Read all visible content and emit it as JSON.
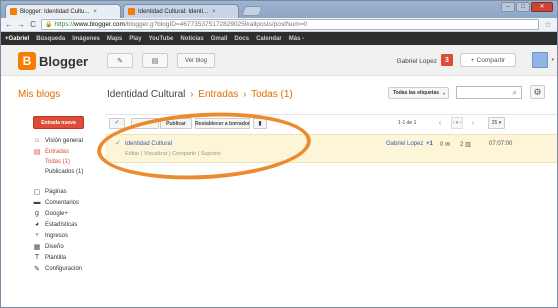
{
  "browser": {
    "tabs": [
      {
        "label": "Blogger: Identidad Cultu..."
      },
      {
        "label": "Identidad Cultural: Identi..."
      }
    ],
    "tab_close": "×",
    "address": {
      "lock": "🔒",
      "scheme": "https://",
      "host": "www.blogger.com",
      "path": "/blogger.g?blogID=467735375172829025l#allposts/postNum=0"
    },
    "back": "←",
    "forward": "→",
    "reload": "C",
    "star": "☆",
    "window_controls": {
      "minimize": "–",
      "maximize": "□",
      "close": "✕"
    }
  },
  "google_bar": {
    "items": [
      "+Gabriel",
      "Búsqueda",
      "Imágenes",
      "Maps",
      "Play",
      "YouTube",
      "Noticias",
      "Gmail",
      "Docs",
      "Calendar",
      "Más -"
    ]
  },
  "header": {
    "logo_mark": "B",
    "logo_text": "Blogger",
    "pencil": "✎",
    "pages": "▤",
    "view_blog": "Ver blog",
    "user_name": "Gabriel Lopez",
    "notifications": "3",
    "share": "+ Compartir",
    "avatar_caret": "▾"
  },
  "sidebar": {
    "title": "Mis blogs",
    "new_entry": "Entrada nueva",
    "items": [
      {
        "icon": "⌂",
        "label": "Visión general"
      },
      {
        "icon": "▤",
        "label": "Entradas"
      },
      {
        "label": "Todas (1)"
      },
      {
        "label": "Publicados (1)"
      },
      {
        "icon": "▢",
        "label": "Páginas"
      },
      {
        "icon": "▬",
        "label": "Comentarios"
      },
      {
        "icon": "g",
        "label": "Google+"
      },
      {
        "icon": "◕",
        "label": "Estadísticas"
      },
      {
        "icon": "♆",
        "label": "Ingresos"
      },
      {
        "icon": "▦",
        "label": "Diseño"
      },
      {
        "icon": "T",
        "label": "Plantilla"
      },
      {
        "icon": "✎",
        "label": "Configuración"
      }
    ]
  },
  "main": {
    "crumb_blog": "Identidad Cultural",
    "crumb_sep": "›",
    "crumb_section": "Entradas",
    "crumb_filter": "Todas (1)",
    "labels_dropdown": "Todas las etiquetas",
    "labels_caret": "▾",
    "search_icon": "⌕",
    "gear": "⚙"
  },
  "toolbar": {
    "check": "✓",
    "label_dd": "▾",
    "publish": "Publicar",
    "revert": "Restablecer a borrador",
    "trash": "▮",
    "count": "1-1 de 1",
    "prev": "‹",
    "page_menu": "‹ ▾ ›",
    "next": "›",
    "per_page": "25 ▾"
  },
  "posts": [
    {
      "check": "✓",
      "title": "Identidad Cultural",
      "actions": "Editar | Visualizar | Compartir | Suprimir",
      "author": "Gabriel Lopez",
      "plus": "+1",
      "comments": "0 ✉",
      "views": "2 ▥",
      "time": "07:07:00"
    }
  ],
  "colors": {
    "brand_orange": "#f57d00",
    "accent_red": "#dd4b39",
    "annotation": "#ec8b2e",
    "row_highlight": "#fdf5d8"
  }
}
